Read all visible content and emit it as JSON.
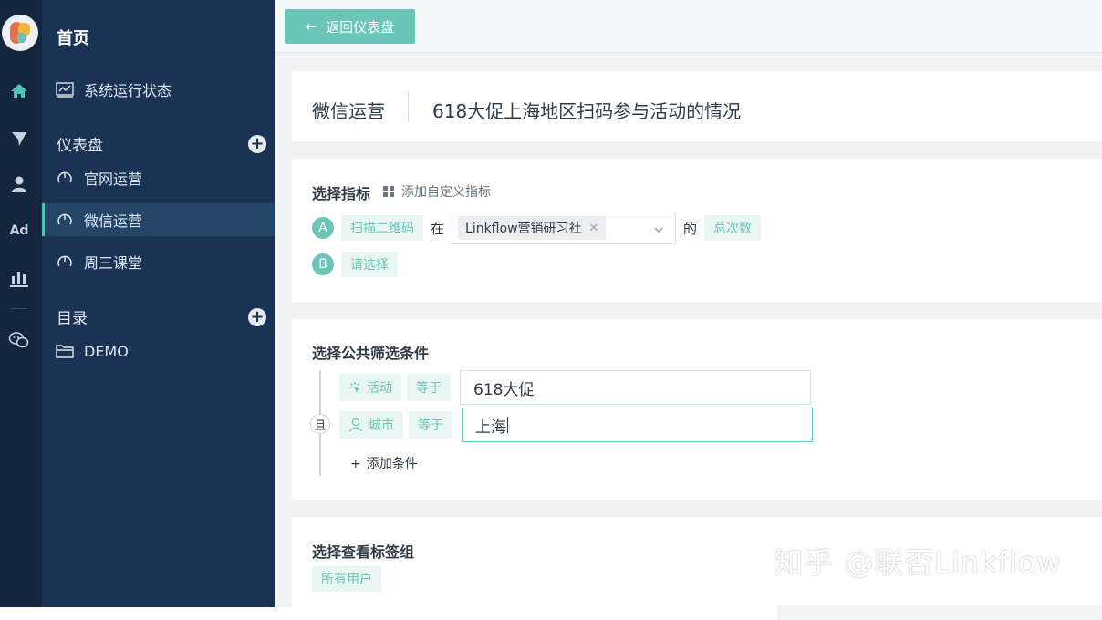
{
  "sidebar": {
    "title": "首页",
    "system_status": "系统运行状态",
    "dashboards_label": "仪表盘",
    "dashboards": [
      {
        "label": "官网运营",
        "active": false
      },
      {
        "label": "微信运营",
        "active": true
      },
      {
        "label": "周三课堂",
        "active": false
      }
    ],
    "catalog_label": "目录",
    "catalog_items": [
      "DEMO"
    ]
  },
  "rail": {
    "icons": [
      "logo",
      "home-icon",
      "send-icon",
      "user-icon",
      "ad-icon",
      "bar-chart-icon",
      "wechat-icon"
    ],
    "ad_label": "Ad"
  },
  "topbar": {
    "back_button": "返回仪表盘"
  },
  "header": {
    "category": "微信运营",
    "title": "618大促上海地区扫码参与活动的情况"
  },
  "metrics": {
    "title": "选择指标",
    "add_custom": "添加自定义指标",
    "rows": [
      {
        "letter": "A",
        "event": "扫描二维码",
        "in": "在",
        "source_tag": "Linkflow营销研习社",
        "of": "的",
        "measure": "总次数"
      },
      {
        "letter": "B",
        "event": "请选择"
      }
    ]
  },
  "filters": {
    "title": "选择公共筛选条件",
    "logic": "且",
    "conditions": [
      {
        "field": "活动",
        "operator": "等于",
        "value": "618大促"
      },
      {
        "field": "城市",
        "operator": "等于",
        "value": "上海"
      }
    ],
    "add_condition": "添加条件"
  },
  "tags": {
    "title": "选择查看标签组",
    "selected": "所有用户"
  },
  "watermark": "知乎 @联否Linkflow",
  "colors": {
    "accent": "#6bc5b8",
    "sidebar_bg": "#1a3354",
    "rail_bg": "#14263d",
    "chip_bg": "#e9f6f3"
  }
}
